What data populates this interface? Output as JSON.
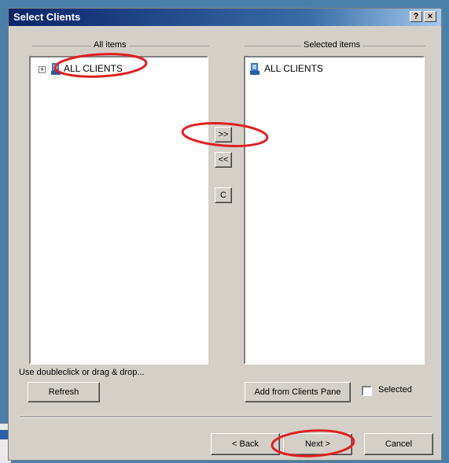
{
  "window": {
    "title": "Select Clients",
    "help_button": "?",
    "close_button": "×"
  },
  "all_items": {
    "label": "All items",
    "tree": [
      {
        "label": "ALL CLIENTS",
        "expander": "+",
        "icon": "client-group-icon"
      }
    ]
  },
  "selected_items": {
    "label": "Selected items",
    "tree": [
      {
        "label": "ALL CLIENTS",
        "icon": "client-group-icon"
      }
    ]
  },
  "transfer": {
    "add_label": ">>",
    "remove_label": "<<",
    "clear_label": "C"
  },
  "hint": "Use doubleclick or drag & drop...",
  "buttons": {
    "refresh": "Refresh",
    "add_from_pane": "Add from Clients Pane",
    "selected_checkbox_label": "Selected",
    "back": "< Back",
    "next": "Next >",
    "cancel": "Cancel"
  },
  "selected_checked": false,
  "annotation_color": "#e02020"
}
